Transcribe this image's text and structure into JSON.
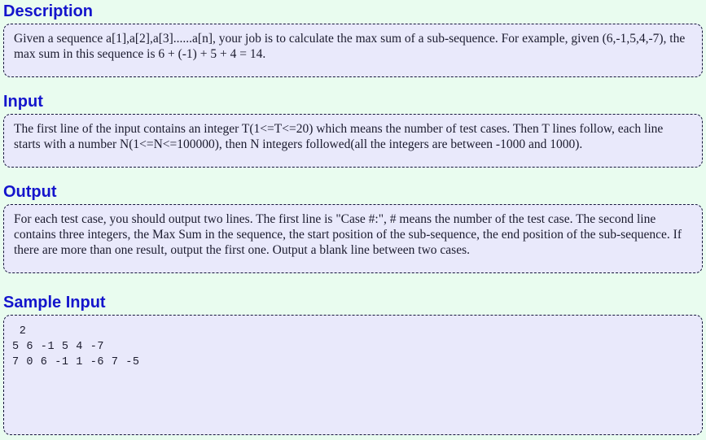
{
  "page": {
    "background_color": "#e9fcef",
    "panel_background_color": "#e9e9fb",
    "heading_color": "#1414cc",
    "panel_border_color": "#16163c",
    "text_color": "#1b1b2e"
  },
  "sections": {
    "description": {
      "heading": "Description",
      "body": "Given a sequence a[1],a[2],a[3]......a[n], your job is to calculate the max sum of a sub-sequence. For example, given (6,-1,5,4,-7), the max sum in this sequence is 6 + (-1) + 5 + 4 = 14."
    },
    "input": {
      "heading": "Input",
      "body": "The first line of the input contains an integer T(1<=T<=20) which means the number of test cases. Then T lines follow, each line starts with a number N(1<=N<=100000), then N integers followed(all the integers are between -1000 and 1000)."
    },
    "output": {
      "heading": "Output",
      "body": "For each test case, you should output two lines. The first line is \"Case #:\", # means the number of the test case. The second line contains three integers, the Max Sum in the sequence, the start position of the sub-sequence, the end position of the sub-sequence. If there are more than one result, output the first one. Output a blank line between two cases."
    },
    "sample_input": {
      "heading": "Sample Input",
      "lines": [
        " 2",
        "5 6 -1 5 4 -7",
        "7 0 6 -1 1 -6 7 -5"
      ],
      "text": " 2\n5 6 -1 5 4 -7\n7 0 6 -1 1 -6 7 -5"
    }
  }
}
